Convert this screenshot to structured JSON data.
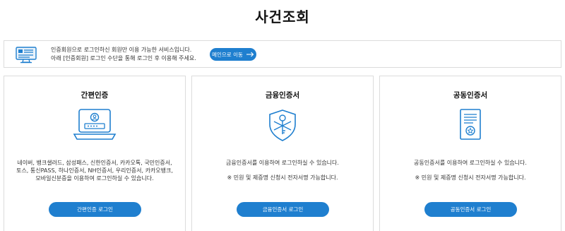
{
  "page": {
    "title": "사건조회"
  },
  "notice": {
    "line1": "인증회원으로 로그인하신 회원만 이용 가능한 서비스입니다.",
    "line2": "아래 [인증회원] 로그인 수단을 통해 로그인 후 이용해 주세요.",
    "main_button_label": "메인으로 이동",
    "icon": "monitor-document-icon"
  },
  "colors": {
    "accent": "#1f7fcf",
    "border": "#dcdcdc"
  },
  "cards": [
    {
      "title": "간편인증",
      "icon": "laptop-login-icon",
      "desc_lines": [
        "네이버, 뱅크샐러드, 삼성패스, 신한인증서, 카카오톡, 국민인증서,",
        "토스, 통신PASS, 하나인증서, NH인증서, 우리인증서, 카카오뱅크,",
        "모바일신분증을 이용하여 로그인하실 수 있습니다."
      ],
      "note": "",
      "button_label": "간편인증 로그인"
    },
    {
      "title": "금융인증서",
      "icon": "shield-key-icon",
      "desc_lines": [
        "금융인증서를 이용하여 로그인하실 수 있습니다."
      ],
      "note": "※ 민원 및 제증명 신청시 전자서명 가능합니다.",
      "button_label": "금융인증서 로그인"
    },
    {
      "title": "공동인증서",
      "icon": "certificate-icon",
      "desc_lines": [
        "공동인증서를 이용하여 로그인하실 수 있습니다."
      ],
      "note": "※ 민원 및 제증명 신청시 전자서명 가능합니다.",
      "button_label": "공동인증서 로그인"
    }
  ]
}
